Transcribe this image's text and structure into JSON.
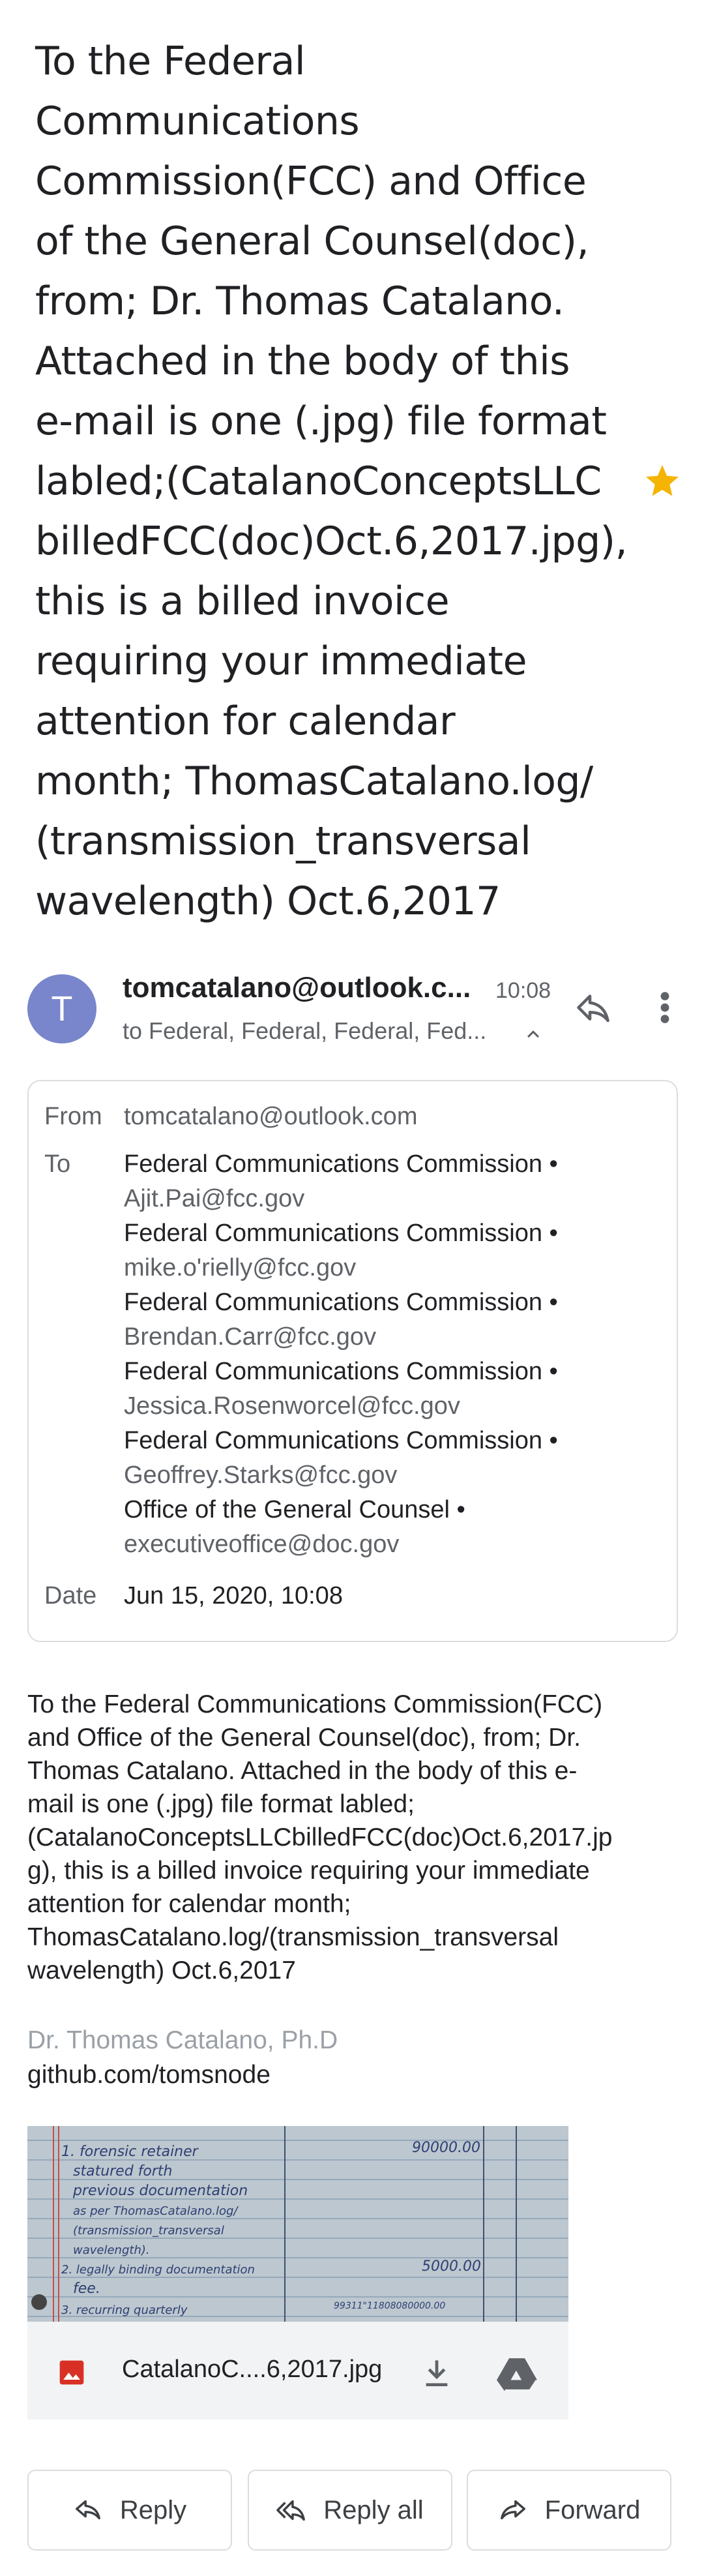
{
  "subject": [
    "To the Federal",
    "Communications",
    "Commission(FCC) and Office",
    "of the General Counsel(doc),",
    "from; Dr. Thomas Catalano.",
    "Attached in the body of this",
    "e-mail is one (.jpg) file format",
    "labled;(CatalanoConceptsLLC",
    "billedFCC(doc)Oct.6,2017.jpg),",
    "this is a billed invoice",
    "requiring your immediate",
    "attention for calendar",
    "month; ThomasCatalano.log/",
    "(transmission_transversal",
    "wavelength) Oct.6,2017"
  ],
  "colors": {
    "star": "#f4b400",
    "avatar": "#7986cb",
    "link": "#202124"
  },
  "header": {
    "avatar_letter": "T",
    "sender": "tomcatalano@outlook.c...",
    "time": "10:08",
    "recipients_summary": "to Federal, Federal, Federal, Fed..."
  },
  "details": {
    "from_label": "From",
    "from": "tomcatalano@outlook.com",
    "to_label": "To",
    "to": [
      {
        "name": "Federal Communications Commission •",
        "email": "Ajit.Pai@fcc.gov"
      },
      {
        "name": "Federal Communications Commission •",
        "email": "mike.o'rielly@fcc.gov"
      },
      {
        "name": "Federal Communications Commission •",
        "email": "Brendan.Carr@fcc.gov"
      },
      {
        "name": "Federal Communications Commission •",
        "email": "Jessica.Rosenworcel@fcc.gov"
      },
      {
        "name": "Federal Communications Commission •",
        "email": "Geoffrey.Starks@fcc.gov"
      },
      {
        "name": "Office of the General Counsel •",
        "email": "executiveoffice@doc.gov"
      }
    ],
    "date_label": "Date",
    "date": "Jun 15, 2020, 10:08"
  },
  "body": [
    "To the Federal Communications Commission(FCC)",
    "and Office of the General Counsel(doc), from; Dr.",
    "Thomas Catalano. Attached in the body of this e-",
    "mail is one (.jpg) file format labled;",
    "(CatalanoConceptsLLCbilledFCC(doc)Oct.6,2017.jp",
    "g), this is a billed invoice requiring your immediate",
    "attention for calendar month;",
    "ThomasCatalano.log/(transmission_transversal",
    "wavelength) Oct.6,2017"
  ],
  "signature": {
    "name": "Dr. Thomas Catalano, Ph.D",
    "link": "github.com/tomsnode"
  },
  "attachment": {
    "filename": "CatalanoC....6,2017.jpg",
    "preview": {
      "item1": [
        "1. forensic retainer",
        "statured forth",
        "previous documentation",
        "as per ThomasCatalano.log/",
        "(transmission_transversal",
        "wavelength)."
      ],
      "amount1": "90000.00",
      "item2": [
        "2. legally binding documentation",
        "fee."
      ],
      "amount2": "5000.00",
      "item3": "3. recurring quarterly",
      "amount3": "99311\"11808080000.00"
    }
  },
  "actions": {
    "reply": "Reply",
    "reply_all": "Reply all",
    "forward": "Forward"
  }
}
